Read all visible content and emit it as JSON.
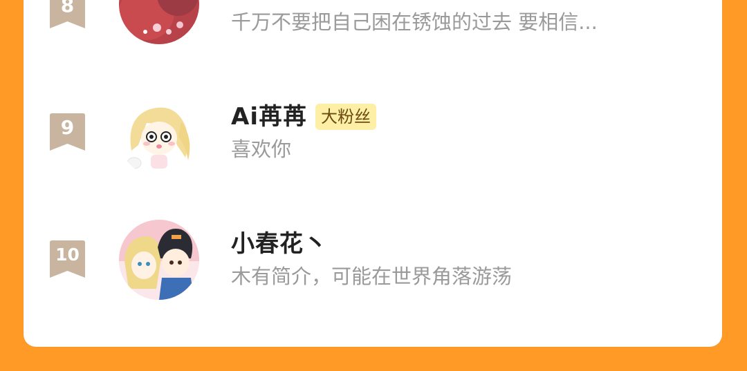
{
  "colors": {
    "background": "#ff9a27",
    "card": "#ffffff",
    "rank_badge": "#c9b59f",
    "fan_badge_bg": "#fdf0a6",
    "name_text": "#222222",
    "bio_text": "#9a9a9a"
  },
  "list": {
    "items": [
      {
        "rank": "8",
        "name": "",
        "badge": "",
        "bio": "千万不要把自己困在锈蚀的过去 要相信..."
      },
      {
        "rank": "9",
        "name": "Ai苒苒",
        "badge": "大粉丝",
        "bio": "喜欢你"
      },
      {
        "rank": "10",
        "name": "小春花丶",
        "badge": "",
        "bio": "木有简介，可能在世界角落游荡"
      }
    ]
  }
}
